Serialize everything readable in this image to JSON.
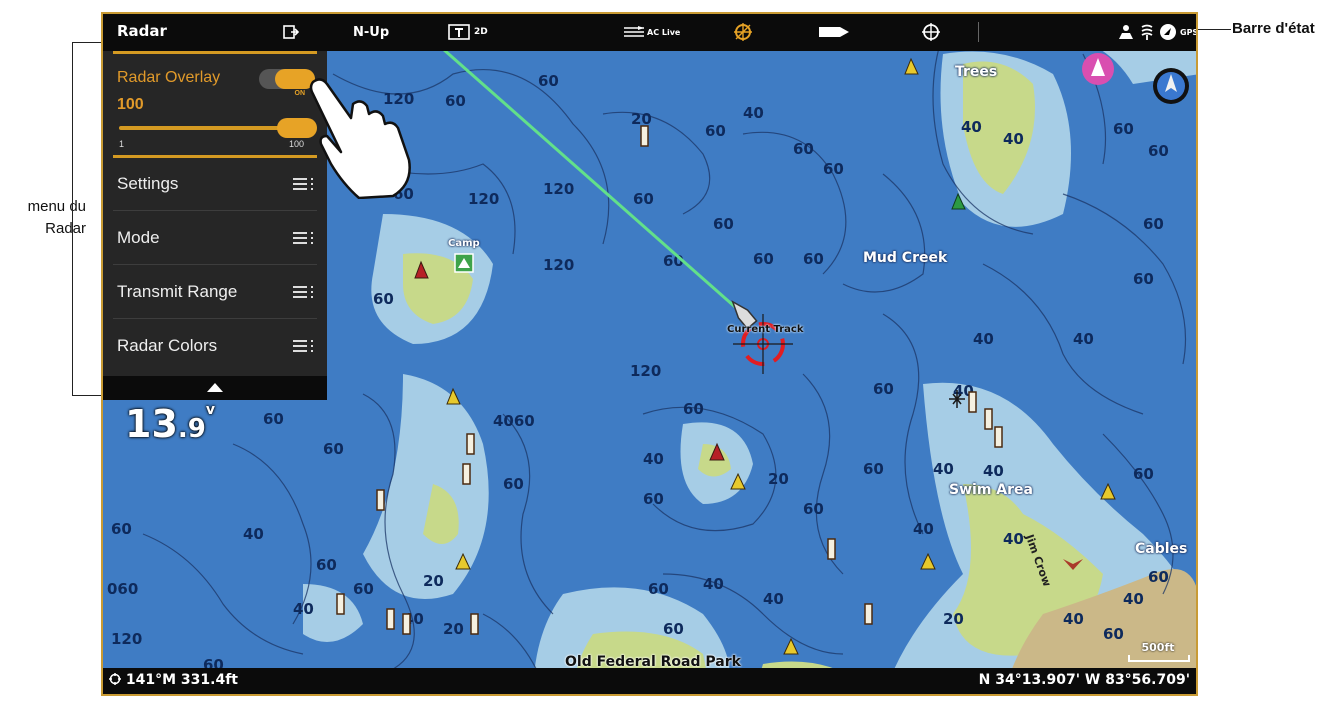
{
  "annotations": {
    "radar_menu_line1": "menu du",
    "radar_menu_line2": "Radar",
    "status_bar": "Barre d'état"
  },
  "topbar": {
    "title": "Radar",
    "orientation": "N-Up",
    "view_mode": "2D",
    "ac_live": "AC Live",
    "gps": "GPS"
  },
  "radar_menu": {
    "overlay_label": "Radar Overlay",
    "overlay_state": "ON",
    "overlay_value": "100",
    "slider_min": "1",
    "slider_max": "100",
    "slider_fraction": 1.0,
    "items": [
      {
        "label": "Settings"
      },
      {
        "label": "Mode"
      },
      {
        "label": "Transmit Range"
      },
      {
        "label": "Radar Colors"
      }
    ]
  },
  "depth": {
    "whole": "13",
    "decimal": ".9",
    "unit": "v"
  },
  "map_labels": {
    "trees": "Trees",
    "mud_creek": "Mud Creek",
    "camp": "Camp",
    "current_track": "Current Track",
    "swim_area": "Swim Area",
    "jim_crow": "Jim Crow",
    "cables": "Cables",
    "old_federal": "Old Federal Road Park",
    "scale": "500ft"
  },
  "depth_contours": [
    "60",
    "120",
    "120",
    "60",
    "60",
    "60",
    "20",
    "40",
    "60",
    "60",
    "60",
    "120",
    "60",
    "60",
    "60",
    "60",
    "40",
    "40",
    "60",
    "60",
    "120",
    "60",
    "20",
    "40",
    "60",
    "20",
    "40",
    "40",
    "40",
    "60",
    "60",
    "60",
    "40",
    "20",
    "60",
    "120",
    "60"
  ],
  "statusbar": {
    "heading": "141°M 331.4ft",
    "coordinates": "N 34°13.907' W 83°56.709'"
  },
  "colors": {
    "water_deep": "#3f7cc4",
    "water_shallow": "#a6cde6",
    "land": "#c7d98a",
    "park": "#cbb888",
    "accent": "#e19a2a",
    "track": "#62e08a"
  }
}
